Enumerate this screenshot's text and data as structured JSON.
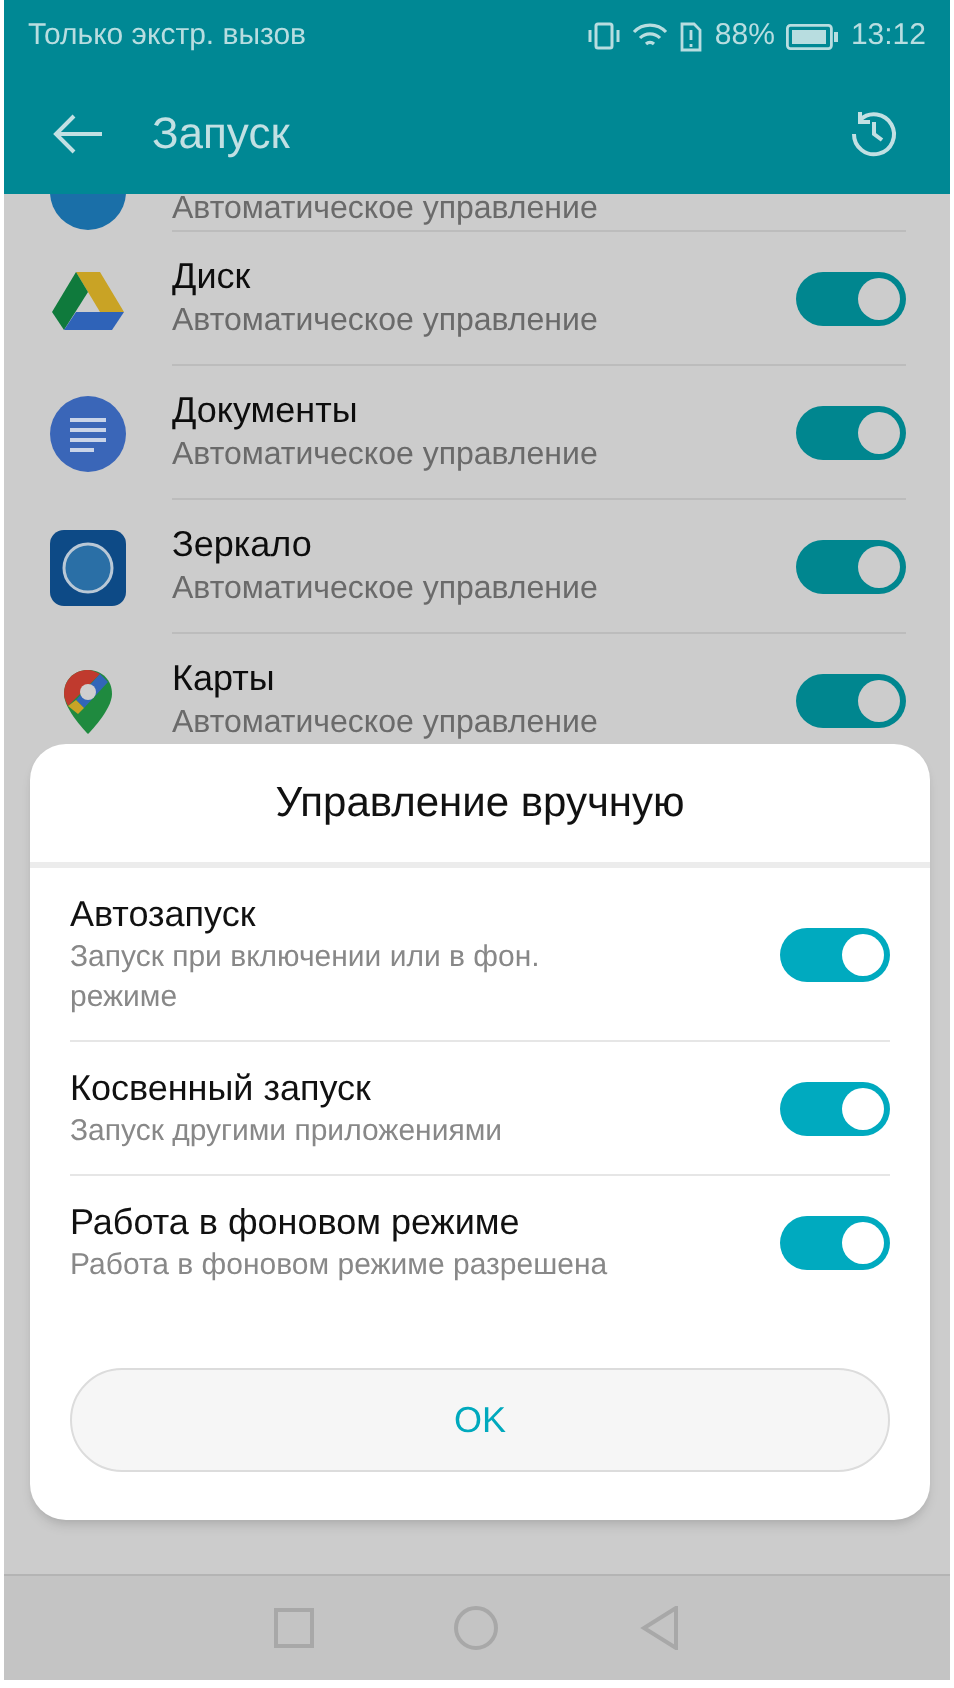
{
  "status_bar": {
    "carrier": "Только экстр. вызов",
    "battery": "88%",
    "time": "13:12"
  },
  "app_bar": {
    "title": "Запуск"
  },
  "apps": [
    {
      "kind": "partial",
      "subtitle": "Автоматическое управление"
    },
    {
      "kind": "drive",
      "name": "Диск",
      "subtitle": "Автоматическое управление",
      "on": true
    },
    {
      "kind": "docs",
      "name": "Документы",
      "subtitle": "Автоматическое управление",
      "on": true
    },
    {
      "kind": "mirror",
      "name": "Зеркало",
      "subtitle": "Автоматическое управление",
      "on": true
    },
    {
      "kind": "maps",
      "name": "Карты",
      "subtitle": "Автоматическое управление",
      "on": true
    }
  ],
  "dialog": {
    "title": "Управление вручную",
    "options": [
      {
        "label": "Автозапуск",
        "description": "Запуск при включении или в фон. режиме",
        "on": true
      },
      {
        "label": "Косвенный запуск",
        "description": "Запуск другими приложениями",
        "on": true
      },
      {
        "label": "Работа в фоновом режиме",
        "description": "Работа в фоновом режиме разрешена",
        "on": true
      }
    ],
    "button": "OK"
  }
}
